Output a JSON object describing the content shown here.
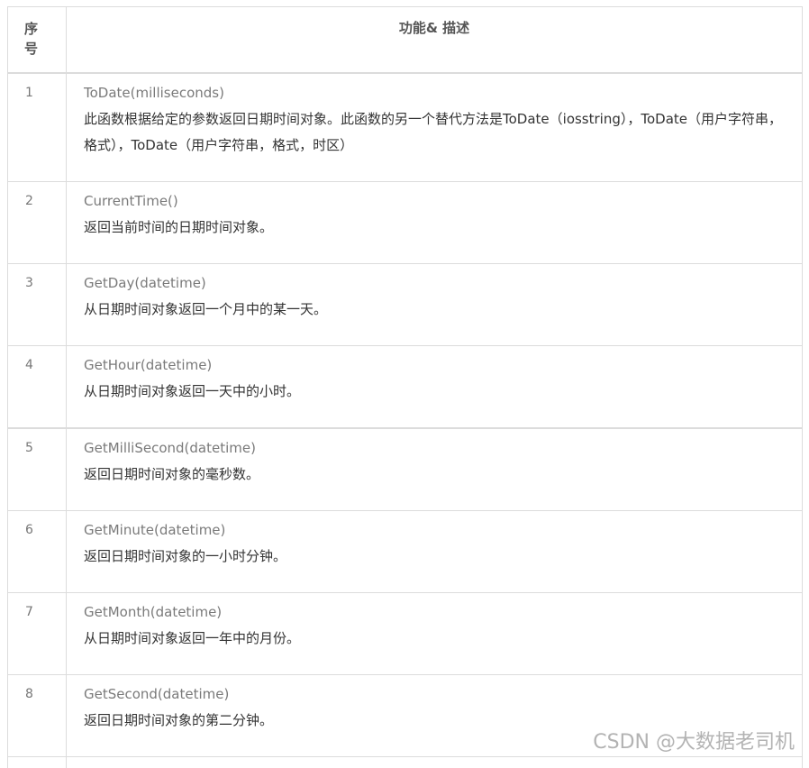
{
  "header": {
    "index_label": "序号",
    "desc_label": "功能& 描述"
  },
  "rows": [
    {
      "index": "1",
      "func": "ToDate(milliseconds)",
      "desc": "此函数根据给定的参数返回日期时间对象。此函数的另一个替代方法是ToDate（iosstring），ToDate（用户字符串，格式），ToDate（用户字符串，格式，时区）"
    },
    {
      "index": "2",
      "func": "CurrentTime()",
      "desc": "返回当前时间的日期时间对象。"
    },
    {
      "index": "3",
      "func": "GetDay(datetime)",
      "desc": "从日期时间对象返回一个月中的某一天。"
    },
    {
      "index": "4",
      "func": "GetHour(datetime)",
      "desc": "从日期时间对象返回一天中的小时。"
    },
    {
      "index": "5",
      "func": "GetMilliSecond(datetime)",
      "desc": "返回日期时间对象的毫秒数。"
    },
    {
      "index": "6",
      "func": "GetMinute(datetime)",
      "desc": "返回日期时间对象的一小时分钟。"
    },
    {
      "index": "7",
      "func": "GetMonth(datetime)",
      "desc": "从日期时间对象返回一年中的月份。"
    },
    {
      "index": "8",
      "func": "GetSecond(datetime)",
      "desc": "返回日期时间对象的第二分钟。"
    }
  ],
  "watermark": "CSDN @大数据老司机"
}
